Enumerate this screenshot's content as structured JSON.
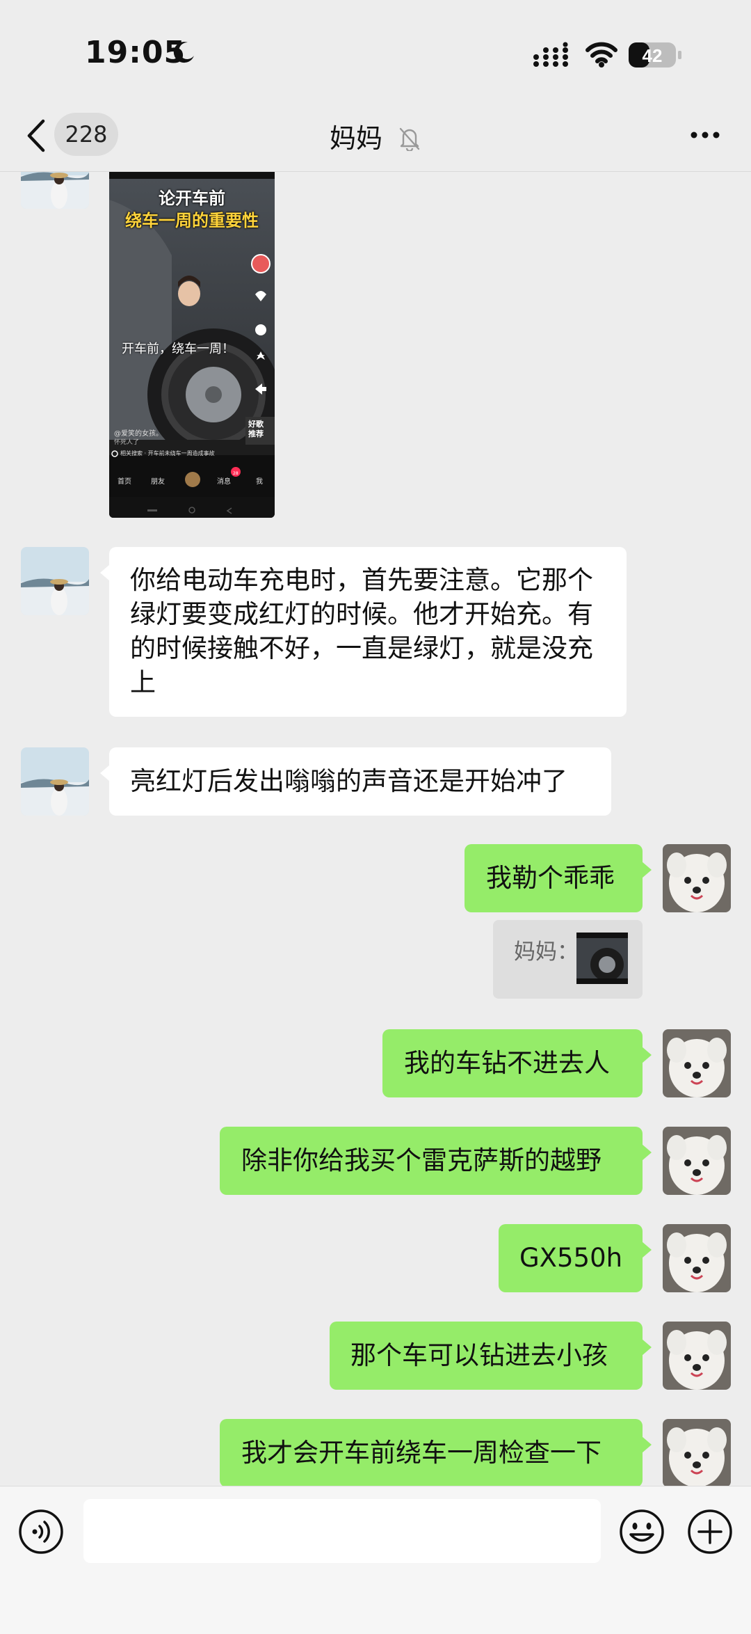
{
  "status_bar": {
    "time": "19:05",
    "battery_level": "42"
  },
  "header": {
    "unread_count": "228",
    "title": "妈妈"
  },
  "video_card": {
    "headline_line1": "论开车前",
    "headline_line2": "绕车一周的重要性",
    "caption": "开车前，绕车一周！",
    "author": "@爱笑的女孩。",
    "sub_author": "怀死人了",
    "side_tag_1": "好歌",
    "side_tag_2": "推荐",
    "search_hint": "相关搜索 · 开车前未绕车一周造成事故",
    "nav_home": "首页",
    "nav_friends": "朋友",
    "nav_messages": "消息",
    "nav_me": "我",
    "nav_badge": "28"
  },
  "messages": [
    {
      "side": "left",
      "text": "你给电动车充电时，首先要注意。它那个绿灯要变成红灯的时候。他才开始充。有的时候接触不好，一直是绿灯，就是没充上"
    },
    {
      "side": "left",
      "text": "亮红灯后发出嗡嗡的声音还是开始冲了"
    },
    {
      "side": "right",
      "text": "我勒个乖乖"
    },
    {
      "side": "right",
      "type": "quote",
      "label": "妈妈："
    },
    {
      "side": "right",
      "text": "我的车钻不进去人"
    },
    {
      "side": "right",
      "text": "除非你给我买个雷克萨斯的越野"
    },
    {
      "side": "right",
      "text": "GX550h"
    },
    {
      "side": "right",
      "text": "那个车可以钻进去小孩"
    },
    {
      "side": "right",
      "text": "我才会开车前绕车一周检查一下"
    }
  ],
  "icons": {
    "back": "chevron-left-icon",
    "mute": "bell-off-icon",
    "more": "more-dots-icon",
    "voice": "voice-icon",
    "emoji": "smile-icon",
    "plus": "plus-icon"
  },
  "colors": {
    "background": "#ededed",
    "sent_bubble": "#95ec69",
    "received_bubble": "#ffffff",
    "quote_bg": "#dedede"
  }
}
